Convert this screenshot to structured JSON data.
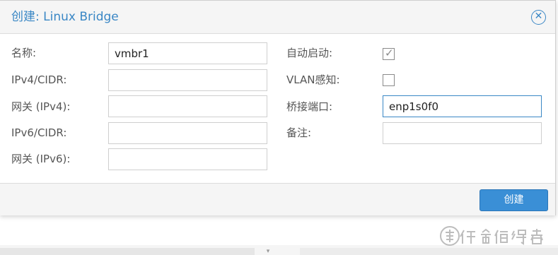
{
  "dialog": {
    "title": "创建: Linux Bridge",
    "close_icon": "close-circle-icon"
  },
  "form": {
    "left": {
      "name": {
        "label": "名称:",
        "value": "vmbr1"
      },
      "ipv4_cidr": {
        "label": "IPv4/CIDR:",
        "value": ""
      },
      "gateway_ipv4": {
        "label": "网关 (IPv4):",
        "value": ""
      },
      "ipv6_cidr": {
        "label": "IPv6/CIDR:",
        "value": ""
      },
      "gateway_ipv6": {
        "label": "网关 (IPv6):",
        "value": ""
      }
    },
    "right": {
      "autostart": {
        "label": "自动启动:",
        "checked": true
      },
      "vlan_aware": {
        "label": "VLAN感知:",
        "checked": false
      },
      "bridge_ports": {
        "label": "桥接端口:",
        "value": "enp1s0f0"
      },
      "comment": {
        "label": "备注:",
        "value": ""
      }
    }
  },
  "footer": {
    "create_label": "创建"
  },
  "watermark": {
    "text": "值 什么值得买"
  },
  "colors": {
    "accent": "#3a87c5",
    "button": "#3a8fd6",
    "header_bg": "#f5f5f5"
  }
}
